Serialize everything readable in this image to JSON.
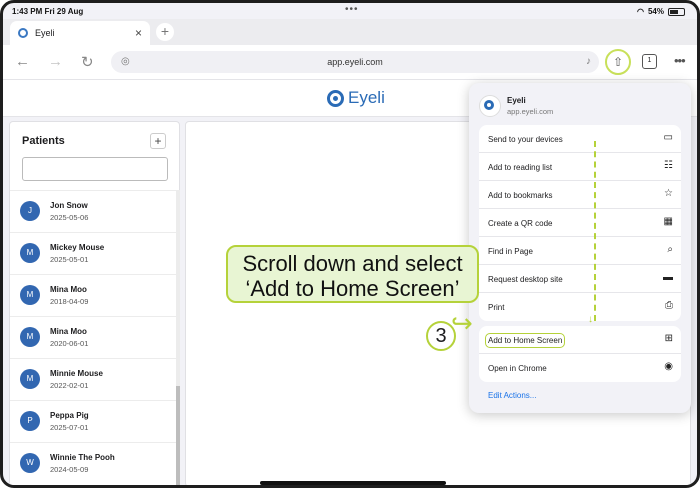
{
  "status": {
    "time": "1:43 PM",
    "date": "Fri 29 Aug",
    "battery": "54%"
  },
  "tab": {
    "title": "Eyeli",
    "close_glyph": "×",
    "new_glyph": "+"
  },
  "toolbar": {
    "back_glyph": "←",
    "forward_glyph": "→",
    "reload_glyph": "↻",
    "url": "app.eyeli.com",
    "tab_count": "1",
    "more_glyph": "•••"
  },
  "header": {
    "logo_text": "Eyeli"
  },
  "sidebar": {
    "title": "Patients",
    "add_glyph": "+",
    "search_placeholder": "",
    "patients": [
      {
        "initial": "J",
        "name": "Jon Snow",
        "date": "2025-05-06"
      },
      {
        "initial": "M",
        "name": "Mickey Mouse",
        "date": "2025-05-01"
      },
      {
        "initial": "M",
        "name": "Mina Moo",
        "date": "2018-04-09"
      },
      {
        "initial": "M",
        "name": "Mina Moo",
        "date": "2020-06-01"
      },
      {
        "initial": "M",
        "name": "Minnie Mouse",
        "date": "2022-02-01"
      },
      {
        "initial": "P",
        "name": "Peppa Pig",
        "date": "2025-07-01"
      },
      {
        "initial": "W",
        "name": "Winnie The Pooh",
        "date": "2024-05-09"
      }
    ]
  },
  "share_sheet": {
    "site_title": "Eyeli",
    "site_url": "app.eyeli.com",
    "actions": [
      {
        "label": "Send to your devices",
        "icon": "▭"
      },
      {
        "label": "Add to reading list",
        "icon": "☷"
      },
      {
        "label": "Add to bookmarks",
        "icon": "☆"
      },
      {
        "label": "Create a QR code",
        "icon": "▦"
      },
      {
        "label": "Find in Page",
        "icon": "⌕"
      },
      {
        "label": "Request desktop site",
        "icon": "▬"
      },
      {
        "label": "Print",
        "icon": "⎙"
      }
    ],
    "actions2": [
      {
        "label": "Add to Home Screen",
        "icon": "⊞"
      },
      {
        "label": "Open in Chrome",
        "icon": "◉"
      }
    ],
    "edit_actions": "Edit Actions..."
  },
  "annotation": {
    "line1": "Scroll down and select",
    "line2": "‘Add to Home Screen’",
    "step_number": "3",
    "accent_color": "#b5d23a"
  }
}
